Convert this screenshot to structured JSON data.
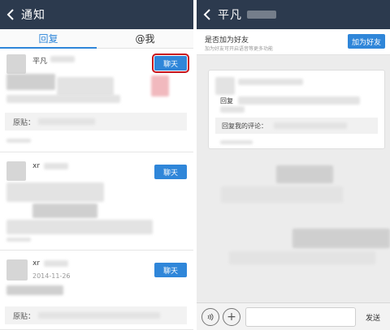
{
  "left": {
    "header": {
      "title": "通知"
    },
    "tabs": [
      {
        "label": "回复",
        "active": true
      },
      {
        "label": "@我",
        "active": false
      }
    ],
    "items": [
      {
        "username": "平凡",
        "chat_label": "聊天",
        "highlighted": true,
        "origin_label": "原贴："
      },
      {
        "username": "xr",
        "chat_label": "聊天",
        "highlighted": false
      },
      {
        "username": "xr",
        "chat_label": "聊天",
        "highlighted": false,
        "date": "2014-11-26",
        "origin_label": "原贴："
      }
    ]
  },
  "right": {
    "header": {
      "title": "平凡"
    },
    "friend_prompt": {
      "title": "是否加为好友",
      "subtitle": "加为好友可开启语音等更多功能",
      "button": "加为好友"
    },
    "message": {
      "reply_prefix": "回复",
      "reply_label": "回复我的评论："
    },
    "input": {
      "send_label": "发送"
    }
  },
  "colors": {
    "header_bg": "#2c3a4e",
    "accent": "#2f86d9",
    "highlight_border": "#c8141c"
  }
}
